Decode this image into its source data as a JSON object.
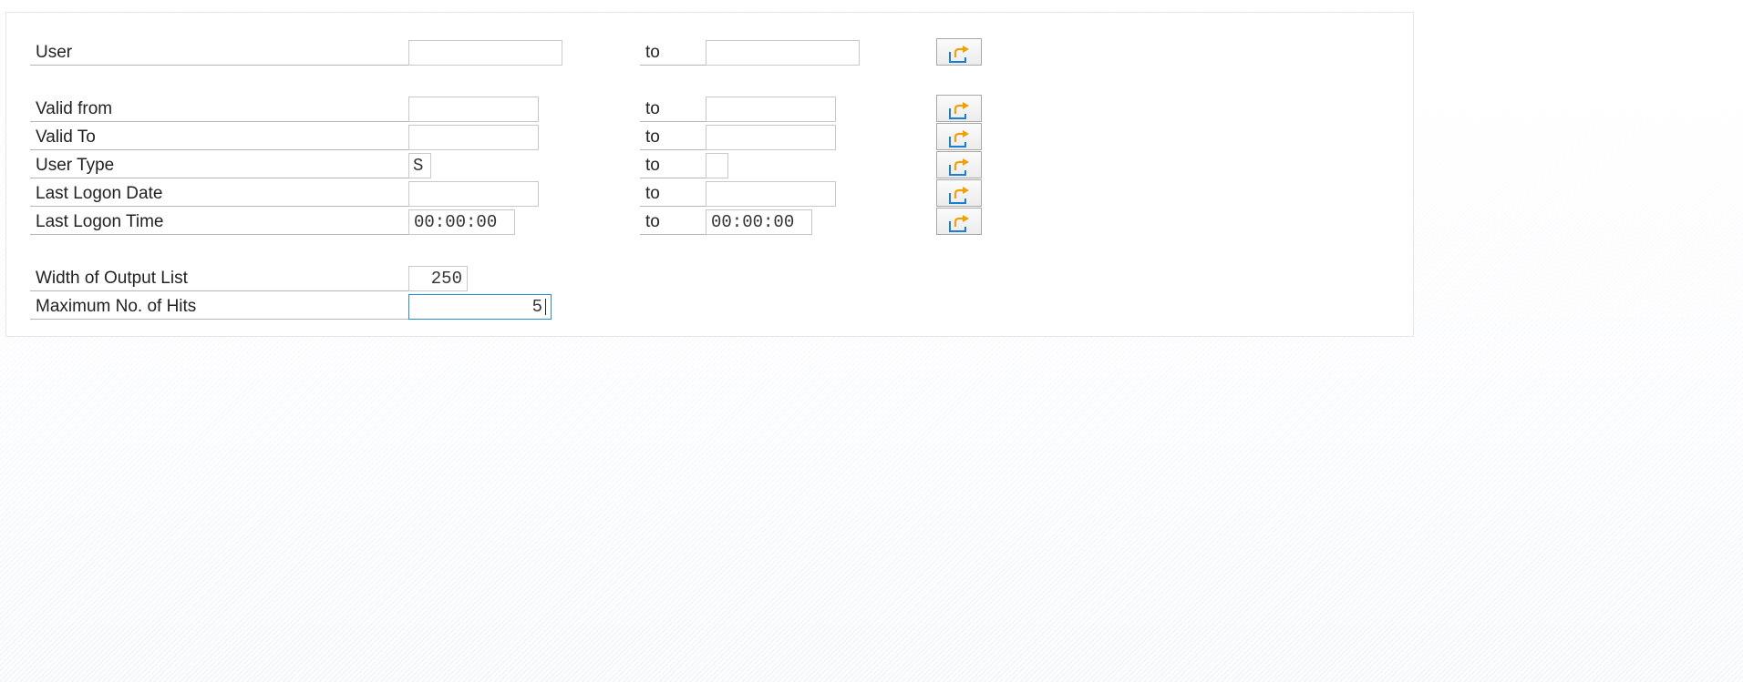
{
  "selection_screen": {
    "rows": [
      {
        "label": "User",
        "from_value": "",
        "to_label": "to",
        "to_value": ""
      },
      {
        "label": "Valid from",
        "from_value": "",
        "to_label": "to",
        "to_value": ""
      },
      {
        "label": "Valid To",
        "from_value": "",
        "to_label": "to",
        "to_value": ""
      },
      {
        "label": "User Type",
        "from_value": "S",
        "to_label": "to",
        "to_value": ""
      },
      {
        "label": "Last Logon Date",
        "from_value": "",
        "to_label": "to",
        "to_value": ""
      },
      {
        "label": "Last Logon Time",
        "from_value": "00:00:00",
        "to_label": "to",
        "to_value": "00:00:00"
      }
    ],
    "width_output_list": {
      "label": "Width of Output List",
      "value": "250"
    },
    "max_hits": {
      "label": "Maximum No. of Hits",
      "value": "5"
    }
  },
  "icons": {
    "multiple_selection": "multiple-selection-arrow-icon"
  },
  "colors": {
    "focus_border": "#2a8bd0",
    "focus_corners": "#c8102e",
    "icon_arrow": "#f0a000",
    "icon_box": "#1a7fd0"
  }
}
